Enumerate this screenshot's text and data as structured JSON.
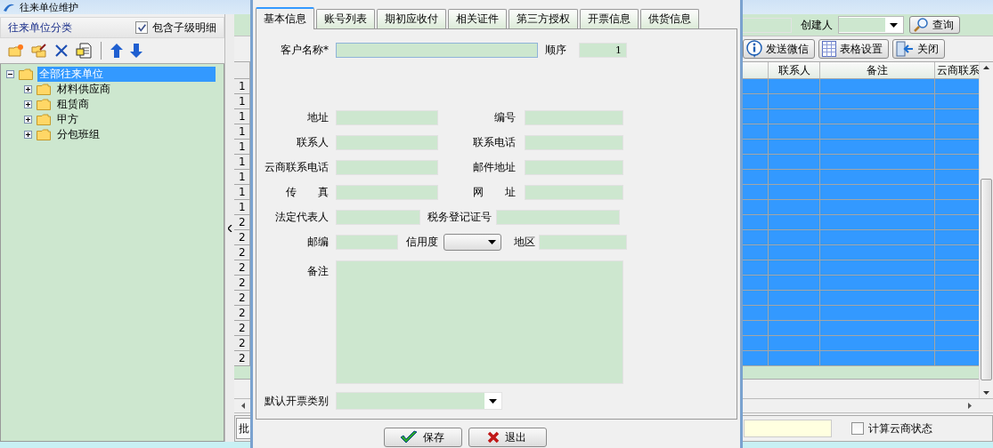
{
  "main_window": {
    "title": "往来单位维护"
  },
  "category_panel": {
    "title": "往来单位分类",
    "include_children": {
      "label": "包含子级明细",
      "checked": true
    }
  },
  "tree": [
    {
      "label": "全部往来单位",
      "expanded": true,
      "selected": true,
      "children": [
        {
          "label": "材料供应商",
          "expanded": false,
          "selected": false
        },
        {
          "label": "租赁商",
          "expanded": false,
          "selected": false
        },
        {
          "label": "甲方",
          "expanded": false,
          "selected": false
        },
        {
          "label": "分包班组",
          "expanded": false,
          "selected": false
        }
      ]
    }
  ],
  "filter_bar": {
    "creator_label": "创建人",
    "search_button": "查询"
  },
  "toolbar_buttons": [
    {
      "label": "发送微信"
    },
    {
      "label": "表格设置"
    },
    {
      "label": "关闭"
    }
  ],
  "grid": {
    "columns": [
      "联系人",
      "备注",
      "云商联系"
    ],
    "rows": [
      {
        "number": "1",
        "selected": true
      },
      {
        "number": "1",
        "selected": true
      },
      {
        "number": "1",
        "selected": true
      },
      {
        "number": "1",
        "selected": true
      },
      {
        "number": "1",
        "selected": true
      },
      {
        "number": "1",
        "selected": true
      },
      {
        "number": "1",
        "selected": true
      },
      {
        "number": "1",
        "selected": true
      },
      {
        "number": "1",
        "selected": true
      },
      {
        "number": "2",
        "selected": true
      },
      {
        "number": "2",
        "selected": true
      },
      {
        "number": "2",
        "selected": true
      },
      {
        "number": "2",
        "selected": true
      },
      {
        "number": "2",
        "selected": true
      },
      {
        "number": "2",
        "selected": true
      },
      {
        "number": "2",
        "selected": true
      },
      {
        "number": "2",
        "selected": true
      },
      {
        "number": "2",
        "selected": true
      },
      {
        "number": "2",
        "selected": true
      }
    ]
  },
  "status_bar": {
    "label": "批",
    "calc_status": {
      "label": "计算云商状态",
      "checked": false
    }
  },
  "dialog": {
    "tabs": [
      {
        "label": "基本信息",
        "selected": true
      },
      {
        "label": "账号列表",
        "selected": false
      },
      {
        "label": "期初应收付",
        "selected": false
      },
      {
        "label": "相关证件",
        "selected": false
      },
      {
        "label": "第三方授权",
        "selected": false
      },
      {
        "label": "开票信息",
        "selected": false
      },
      {
        "label": "供货信息",
        "selected": false
      }
    ],
    "fields": {
      "name": {
        "label": "客户名称*"
      },
      "order": {
        "label": "顺序",
        "value": "1"
      },
      "address": {
        "label": "地址"
      },
      "code": {
        "label": "编号"
      },
      "contact": {
        "label": "联系人"
      },
      "phone": {
        "label": "联系电话"
      },
      "cloud_phone": {
        "label": "云商联系电话"
      },
      "email": {
        "label": "邮件地址"
      },
      "fax": {
        "label": "传　　真"
      },
      "website": {
        "label": "网　　址"
      },
      "legal_rep": {
        "label": "法定代表人"
      },
      "tax_no": {
        "label": "税务登记证号"
      },
      "postcode": {
        "label": "邮编"
      },
      "credit": {
        "label": "信用度"
      },
      "region": {
        "label": "地区"
      },
      "remarks": {
        "label": "备注"
      },
      "invoice_type": {
        "label": "默认开票类别"
      }
    },
    "buttons": [
      {
        "label": "保存"
      },
      {
        "label": "退出"
      }
    ]
  }
}
